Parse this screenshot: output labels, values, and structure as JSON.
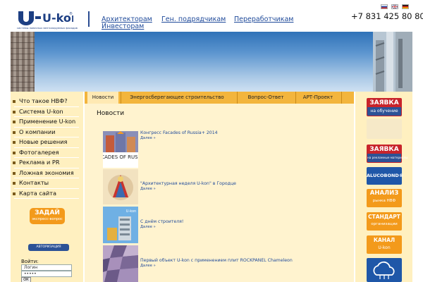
{
  "logo": {
    "brand": "U-kon",
    "registered": "®",
    "tagline": "системы навесных вентилируемых фасадов"
  },
  "top_nav": [
    "Архитекторам",
    "Ген. подрядчикам",
    "Переработчикам",
    "Инвесторам"
  ],
  "languages": [
    {
      "code": "ru",
      "colors": [
        "#ffffff",
        "#2d4fa8",
        "#d62a24"
      ]
    },
    {
      "code": "en",
      "colors": [
        "#20367a",
        "#ffffff",
        "#cc2b2b"
      ]
    },
    {
      "code": "de",
      "colors": [
        "#111111",
        "#d4261d",
        "#f5c300"
      ]
    }
  ],
  "phone": "+7 831 425 80 80",
  "left_menu": [
    "Что такое НВФ?",
    "Система U-kon",
    "Применение U-kon",
    "О компании",
    "Новые решения",
    "Фотогалерея",
    "Реклама и PR",
    "Ложная экономия",
    "Контакты",
    "Карта сайта"
  ],
  "zadai": {
    "title": "ЗАДАЙ",
    "subtitle": "экспресс-вопрос"
  },
  "auth": {
    "button": "АВТОРИЗАЦИЯ",
    "label": "Войти:",
    "login_value": "Логин",
    "password_value": "•••••",
    "ok": "ОК"
  },
  "tabs": [
    "Новости",
    "Энергосберегающее строительство",
    "Вопрос-Ответ",
    "АРТ-Проект"
  ],
  "content_title": "Новости",
  "news": [
    {
      "title": "Конгресс Facades of Russia+ 2014",
      "more": "Далее »",
      "thumb_text": "FACADES OF RUSSIA"
    },
    {
      "title": "\"Архитектурная неделя U-kon\" в Городце",
      "more": "Далее »"
    },
    {
      "title": "С днём строителя!",
      "more": "Далее »",
      "thumb_text": "U-kon"
    },
    {
      "title": "Первый объект U-kon с применением плит ROCKPANEL Chameleon",
      "more": "Далее »"
    }
  ],
  "right_banners": {
    "zayavka1": {
      "title": "ЗАЯВКА",
      "subtitle": "на обучение"
    },
    "zayavka2": {
      "title": "ЗАЯВКА",
      "subtitle": "на рекламные материалы"
    },
    "alucobond": "ALUCOBOND®",
    "analiz": {
      "title": "АНАЛИЗ",
      "subtitle": "рынка НВФ"
    },
    "standart": {
      "title": "СТАНДАРТ",
      "subtitle": "организации"
    },
    "kanal": {
      "title": "КАНАЛ",
      "subtitle": "U-kon"
    }
  },
  "colors": {
    "brand_blue": "#1d3f83",
    "link_blue": "#1f4a9a",
    "orange": "#f39a1b",
    "tab_orange": "#f3b53d",
    "panel_cream": "#fff0c0",
    "content_cream": "#fff3cf",
    "red_banner": "#c8242b"
  }
}
